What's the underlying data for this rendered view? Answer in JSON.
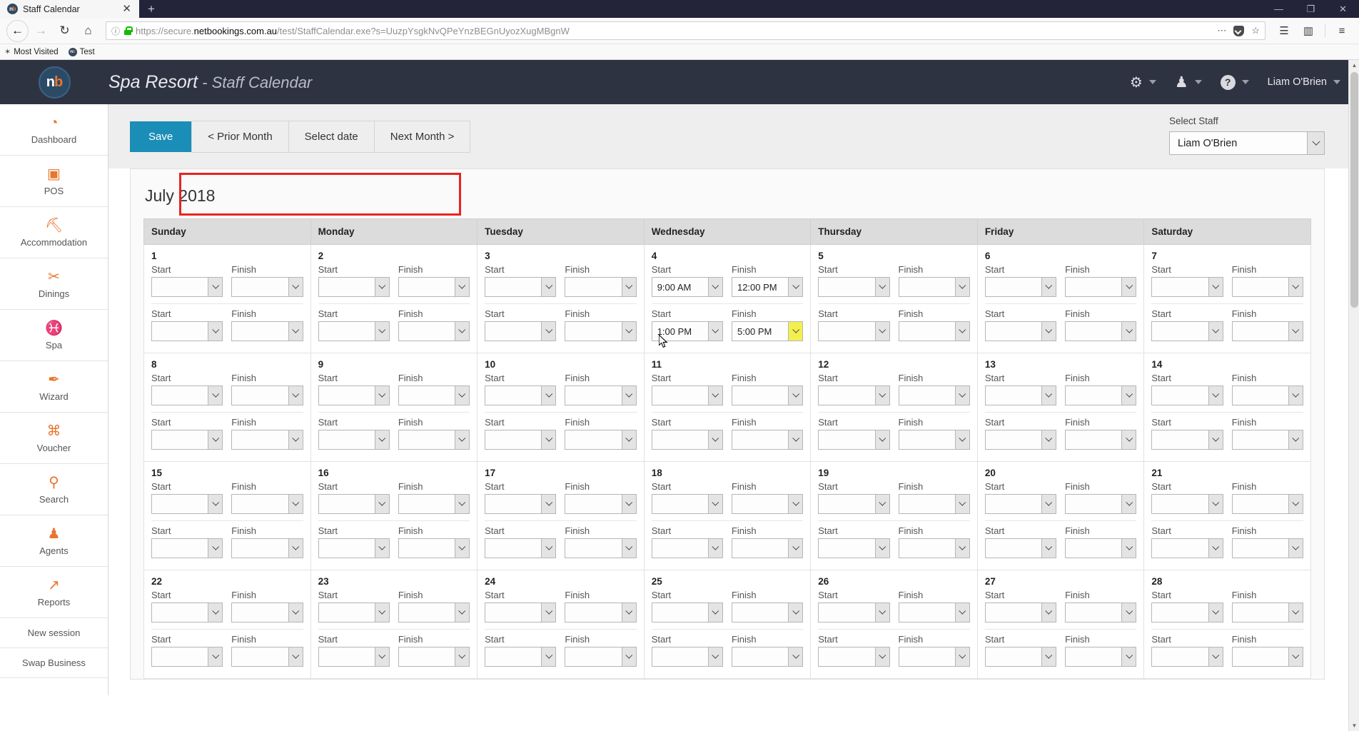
{
  "browser": {
    "tab_title": "Staff Calendar",
    "tab_favicon_text": "n",
    "tab_favicon_accent": "b",
    "new_tab_label": "+",
    "window_minimize": "—",
    "window_maximize": "❐",
    "window_close": "✕",
    "back_icon": "←",
    "forward_icon": "→",
    "reload_icon": "↻",
    "home_icon": "⌂",
    "identity_icon": "ⓘ",
    "url_prefix": "https://secure.",
    "url_domain": "netbookings.com.au",
    "url_suffix": "/test/StaffCalendar.exe?s=UuzpYsgkNvQPeYnzBEGnUyozXugMBgnW",
    "url_full": "https://secure.netbookings.com.au/test/StaffCalendar.exe?s=UuzpYsgkNvQPeYnzBEGnUyozXugMBgnW",
    "page_actions_icon": "⋯",
    "bookmark_star_icon": "☆",
    "library_icon": "☰",
    "sidebar_icon": "▥",
    "menu_icon": "≡",
    "bookmarks": [
      {
        "label": "Most Visited",
        "icon": "star-icon"
      },
      {
        "label": "Test",
        "icon": "netbookings-favicon"
      }
    ]
  },
  "app_header": {
    "logo_text": "n",
    "logo_accent": "b",
    "title": "Spa Resort",
    "separator": " - ",
    "subtitle": "Staff Calendar",
    "gear_icon": "⚙",
    "user_icon": "♟",
    "help_icon": "?",
    "user_name": "Liam O'Brien"
  },
  "sidebar": {
    "items": [
      {
        "label": "Dashboard",
        "icon": "◔"
      },
      {
        "label": "POS",
        "icon": "▣"
      },
      {
        "label": "Accommodation",
        "icon": "⛏"
      },
      {
        "label": "Dinings",
        "icon": "✂"
      },
      {
        "label": "Spa",
        "icon": "♓"
      },
      {
        "label": "Wizard",
        "icon": "✒"
      },
      {
        "label": "Voucher",
        "icon": "⌘"
      },
      {
        "label": "Search",
        "icon": "⚲"
      },
      {
        "label": "Agents",
        "icon": "♟"
      },
      {
        "label": "Reports",
        "icon": "↗"
      }
    ],
    "plain_items": [
      {
        "label": "New session"
      },
      {
        "label": "Swap Business"
      }
    ]
  },
  "toolbar": {
    "save_label": "Save",
    "prior_month_label": "< Prior Month",
    "select_date_label": "Select date",
    "next_month_label": "Next Month >",
    "highlight_color": "#e8241f"
  },
  "staff_picker": {
    "label": "Select Staff",
    "selected": "Liam O'Brien"
  },
  "calendar": {
    "month_title": "July 2018",
    "day_headers": [
      "Sunday",
      "Monday",
      "Tuesday",
      "Wednesday",
      "Thursday",
      "Friday",
      "Saturday"
    ],
    "field_labels": {
      "start": "Start",
      "finish": "Finish"
    },
    "weeks": [
      [
        {
          "day": "1",
          "shifts": [
            {
              "start": "",
              "finish": ""
            },
            {
              "start": "",
              "finish": ""
            }
          ]
        },
        {
          "day": "2",
          "shifts": [
            {
              "start": "",
              "finish": ""
            },
            {
              "start": "",
              "finish": ""
            }
          ]
        },
        {
          "day": "3",
          "shifts": [
            {
              "start": "",
              "finish": ""
            },
            {
              "start": "",
              "finish": ""
            }
          ]
        },
        {
          "day": "4",
          "shifts": [
            {
              "start": "9:00 AM",
              "finish": "12:00 PM"
            },
            {
              "start": "1:00 PM",
              "finish": "5:00 PM",
              "finish_highlighted": true
            }
          ]
        },
        {
          "day": "5",
          "shifts": [
            {
              "start": "",
              "finish": ""
            },
            {
              "start": "",
              "finish": ""
            }
          ]
        },
        {
          "day": "6",
          "shifts": [
            {
              "start": "",
              "finish": ""
            },
            {
              "start": "",
              "finish": ""
            }
          ]
        },
        {
          "day": "7",
          "shifts": [
            {
              "start": "",
              "finish": ""
            },
            {
              "start": "",
              "finish": ""
            }
          ]
        }
      ],
      [
        {
          "day": "8",
          "shifts": [
            {
              "start": "",
              "finish": ""
            },
            {
              "start": "",
              "finish": ""
            }
          ]
        },
        {
          "day": "9",
          "shifts": [
            {
              "start": "",
              "finish": ""
            },
            {
              "start": "",
              "finish": ""
            }
          ]
        },
        {
          "day": "10",
          "shifts": [
            {
              "start": "",
              "finish": ""
            },
            {
              "start": "",
              "finish": ""
            }
          ]
        },
        {
          "day": "11",
          "shifts": [
            {
              "start": "",
              "finish": ""
            },
            {
              "start": "",
              "finish": ""
            }
          ]
        },
        {
          "day": "12",
          "shifts": [
            {
              "start": "",
              "finish": ""
            },
            {
              "start": "",
              "finish": ""
            }
          ]
        },
        {
          "day": "13",
          "shifts": [
            {
              "start": "",
              "finish": ""
            },
            {
              "start": "",
              "finish": ""
            }
          ]
        },
        {
          "day": "14",
          "shifts": [
            {
              "start": "",
              "finish": ""
            },
            {
              "start": "",
              "finish": ""
            }
          ]
        }
      ],
      [
        {
          "day": "15",
          "shifts": [
            {
              "start": "",
              "finish": ""
            },
            {
              "start": "",
              "finish": ""
            }
          ]
        },
        {
          "day": "16",
          "shifts": [
            {
              "start": "",
              "finish": ""
            },
            {
              "start": "",
              "finish": ""
            }
          ]
        },
        {
          "day": "17",
          "shifts": [
            {
              "start": "",
              "finish": ""
            },
            {
              "start": "",
              "finish": ""
            }
          ]
        },
        {
          "day": "18",
          "shifts": [
            {
              "start": "",
              "finish": ""
            },
            {
              "start": "",
              "finish": ""
            }
          ]
        },
        {
          "day": "19",
          "shifts": [
            {
              "start": "",
              "finish": ""
            },
            {
              "start": "",
              "finish": ""
            }
          ]
        },
        {
          "day": "20",
          "shifts": [
            {
              "start": "",
              "finish": ""
            },
            {
              "start": "",
              "finish": ""
            }
          ]
        },
        {
          "day": "21",
          "shifts": [
            {
              "start": "",
              "finish": ""
            },
            {
              "start": "",
              "finish": ""
            }
          ]
        }
      ],
      [
        {
          "day": "22",
          "shifts": [
            {
              "start": "",
              "finish": ""
            },
            {
              "start": "",
              "finish": ""
            }
          ]
        },
        {
          "day": "23",
          "shifts": [
            {
              "start": "",
              "finish": ""
            },
            {
              "start": "",
              "finish": ""
            }
          ]
        },
        {
          "day": "24",
          "shifts": [
            {
              "start": "",
              "finish": ""
            },
            {
              "start": "",
              "finish": ""
            }
          ]
        },
        {
          "day": "25",
          "shifts": [
            {
              "start": "",
              "finish": ""
            },
            {
              "start": "",
              "finish": ""
            }
          ]
        },
        {
          "day": "26",
          "shifts": [
            {
              "start": "",
              "finish": ""
            },
            {
              "start": "",
              "finish": ""
            }
          ]
        },
        {
          "day": "27",
          "shifts": [
            {
              "start": "",
              "finish": ""
            },
            {
              "start": "",
              "finish": ""
            }
          ]
        },
        {
          "day": "28",
          "shifts": [
            {
              "start": "",
              "finish": ""
            },
            {
              "start": "",
              "finish": ""
            }
          ]
        }
      ]
    ]
  }
}
